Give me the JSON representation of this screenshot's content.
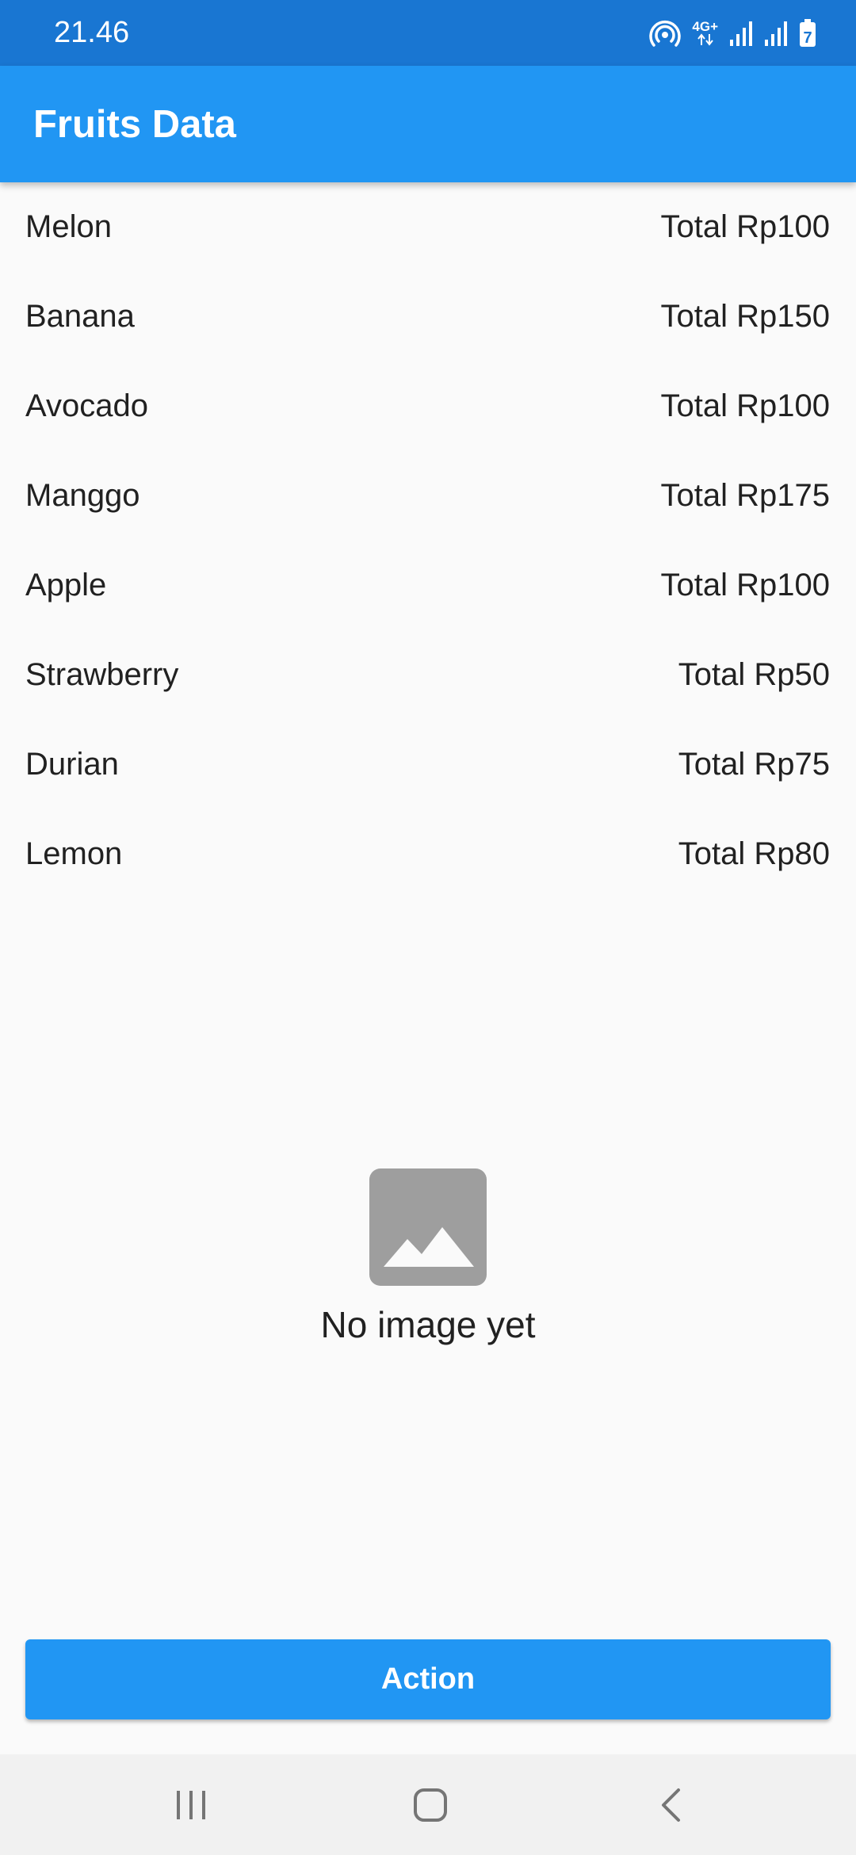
{
  "status_bar": {
    "time": "21.46",
    "network_type": "4G+",
    "battery_level": "7",
    "icons": [
      "hotspot-icon",
      "network-type-icon",
      "signal-icon",
      "signal-icon",
      "battery-icon"
    ]
  },
  "app_bar": {
    "title": "Fruits Data"
  },
  "fruits": [
    {
      "name": "Melon",
      "total": "Total Rp100"
    },
    {
      "name": "Banana",
      "total": "Total Rp150"
    },
    {
      "name": "Avocado",
      "total": "Total Rp100"
    },
    {
      "name": "Manggo",
      "total": "Total Rp175"
    },
    {
      "name": "Apple",
      "total": "Total Rp100"
    },
    {
      "name": "Strawberry",
      "total": "Total Rp50"
    },
    {
      "name": "Durian",
      "total": "Total Rp75"
    },
    {
      "name": "Lemon",
      "total": "Total Rp80"
    }
  ],
  "empty_state": {
    "icon": "image-placeholder-icon",
    "text": "No image yet"
  },
  "action_button": {
    "label": "Action"
  },
  "nav_bar": {
    "icons": [
      "recents-icon",
      "home-icon",
      "back-icon"
    ]
  },
  "colors": {
    "status_bar": "#1976d2",
    "primary": "#2196f3",
    "background": "#fafafa",
    "placeholder": "#9e9e9e",
    "nav_bar": "#f1f1f1"
  }
}
